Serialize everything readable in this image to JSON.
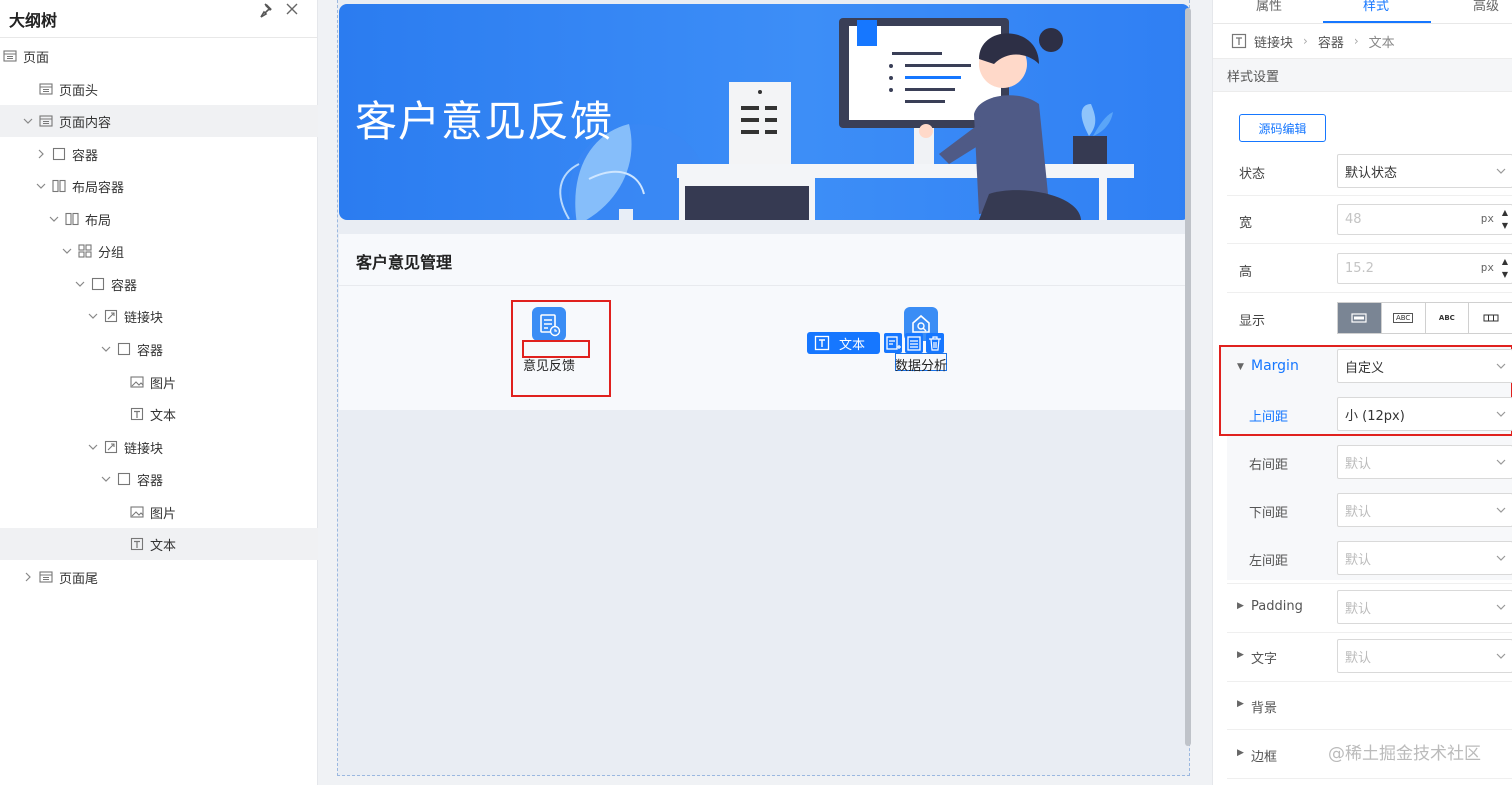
{
  "outline": {
    "title": "大纲树",
    "nodes": [
      {
        "label": "页面",
        "icon": "page-icon"
      },
      {
        "label": "页面头",
        "icon": "page-section-icon"
      },
      {
        "label": "页面内容",
        "icon": "page-section-icon",
        "expanded": true
      },
      {
        "label": "容器",
        "icon": "container-icon",
        "expanded": false
      },
      {
        "label": "布局容器",
        "icon": "layout-icon",
        "expanded": true
      },
      {
        "label": "布局",
        "icon": "layout-icon",
        "expanded": true
      },
      {
        "label": "分组",
        "icon": "group-icon",
        "expanded": true
      },
      {
        "label": "容器",
        "icon": "container-icon",
        "expanded": true
      },
      {
        "label": "链接块",
        "icon": "link-icon",
        "expanded": true
      },
      {
        "label": "容器",
        "icon": "container-icon",
        "expanded": true
      },
      {
        "label": "图片",
        "icon": "image-icon"
      },
      {
        "label": "文本",
        "icon": "text-icon"
      },
      {
        "label": "链接块",
        "icon": "link-icon",
        "expanded": true
      },
      {
        "label": "容器",
        "icon": "container-icon",
        "expanded": true
      },
      {
        "label": "图片",
        "icon": "image-icon"
      },
      {
        "label": "文本",
        "icon": "text-icon",
        "selected": true
      },
      {
        "label": "页面尾",
        "icon": "page-section-icon",
        "expanded": false
      }
    ]
  },
  "canvas": {
    "banner_title": "客户意见反馈",
    "panel_title": "客户意见管理",
    "tiles": [
      {
        "label": "意见反馈",
        "icon": "feedback-icon"
      },
      {
        "label": "数据分析",
        "icon": "analysis-icon"
      }
    ],
    "selection_tag": "文本"
  },
  "props": {
    "tabs": [
      "属性",
      "样式",
      "高级"
    ],
    "active_tab": "样式",
    "breadcrumb": [
      "链接块",
      "容器",
      "文本"
    ],
    "section_title": "样式设置",
    "source_button": "源码编辑",
    "state": {
      "label": "状态",
      "value": "默认状态"
    },
    "width": {
      "label": "宽",
      "value": "48",
      "unit": "px"
    },
    "height": {
      "label": "高",
      "value": "15.2",
      "unit": "px"
    },
    "display": {
      "label": "显示",
      "options": [
        "",
        "ABC",
        "ABC",
        ""
      ],
      "active_index": 0
    },
    "margin": {
      "label": "Margin",
      "value": "自定义"
    },
    "margin_top": {
      "label": "上间距",
      "value": "小 (12px)"
    },
    "margin_right": {
      "label": "右间距",
      "value": "默认"
    },
    "margin_bottom": {
      "label": "下间距",
      "value": "默认"
    },
    "margin_left": {
      "label": "左间距",
      "value": "默认"
    },
    "padding": {
      "label": "Padding",
      "value": "默认"
    },
    "font": {
      "label": "文字",
      "value": "默认"
    },
    "background": {
      "label": "背景"
    },
    "border": {
      "label": "边框"
    }
  },
  "watermark": "@稀土掘金技术社区",
  "colors": {
    "accent": "#1677ff",
    "banner": "#2f80f2",
    "highlight_red": "#e0211e"
  }
}
